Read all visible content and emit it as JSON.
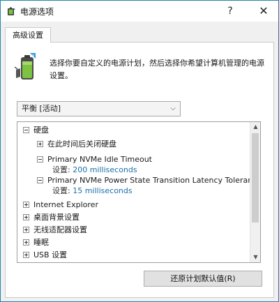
{
  "window": {
    "title": "电源选项",
    "help_glyph": "?",
    "close_glyph": "✕"
  },
  "tab": {
    "label": "高级设置"
  },
  "description": "选择你要自定义的电源计划，然后选择你希望计算机管理的电源设置。",
  "plan_select": {
    "value": "平衡 [活动]",
    "chevron": "⌵"
  },
  "tree": {
    "hard_disk": "硬盘",
    "turn_off_after": "在此时间后关闭硬盘",
    "nvme_idle_timeout": {
      "label": "Primary NVMe Idle Timeout",
      "setting_label": "设置:",
      "setting_value": "200 milliseconds"
    },
    "nvme_latency": {
      "label": "Primary NVMe Power State Transition Latency Tolerance",
      "setting_label": "设置:",
      "setting_value": "15 milliseconds"
    },
    "items": [
      "Internet Explorer",
      "桌面背景设置",
      "无线适配器设置",
      "睡眠",
      "USB 设置"
    ]
  },
  "scrollbar": {
    "up_glyph": "▲",
    "down_glyph": "▼"
  },
  "restore_button": "还原计划默认值(R)",
  "colors": {
    "title_bar": "#ffffff",
    "window_border": "#1f86ad",
    "setting_value": "#1b6fa8"
  },
  "icons": {
    "title": "power-options-icon",
    "header": "battery-power-icon"
  }
}
